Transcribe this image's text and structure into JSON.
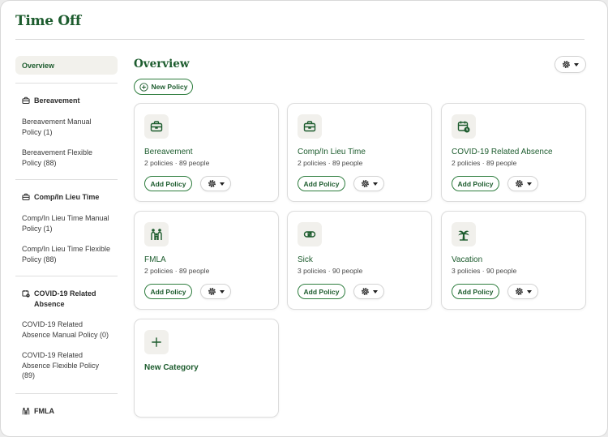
{
  "header": {
    "title": "Time Off"
  },
  "sidebar": {
    "overview_label": "Overview",
    "groups": [
      {
        "label": "Bereavement",
        "icon": "briefcase-icon",
        "items": [
          "Bereavement Manual Policy (1)",
          "Bereavement Flexible Policy (88)"
        ]
      },
      {
        "label": "Comp/In Lieu Time",
        "icon": "briefcase-icon",
        "items": [
          "Comp/In Lieu Time Manual Policy (1)",
          "Comp/In Lieu Time Flexible Policy (88)"
        ]
      },
      {
        "label": "COVID-19 Related Absence",
        "icon": "calendar-clock-icon",
        "items": [
          "COVID-19 Related Absence Manual Policy (0)",
          "COVID-19 Related Absence Flexible Policy (89)"
        ]
      },
      {
        "label": "FMLA",
        "icon": "family-icon",
        "items": []
      }
    ]
  },
  "main": {
    "title": "Overview",
    "new_policy_label": "New Policy",
    "settings_icon": "gear-icon",
    "cards": [
      {
        "name": "Bereavement",
        "meta": "2 policies · 89 people",
        "icon": "briefcase-icon",
        "add_label": "Add Policy"
      },
      {
        "name": "Comp/In Lieu Time",
        "meta": "2 policies · 89 people",
        "icon": "briefcase-icon",
        "add_label": "Add Policy"
      },
      {
        "name": "COVID-19 Related Absence",
        "meta": "2 policies · 89 people",
        "icon": "calendar-clock-icon",
        "add_label": "Add Policy"
      },
      {
        "name": "FMLA",
        "meta": "2 policies · 89 people",
        "icon": "family-icon",
        "add_label": "Add Policy"
      },
      {
        "name": "Sick",
        "meta": "3 policies · 90 people",
        "icon": "bandage-icon",
        "add_label": "Add Policy"
      },
      {
        "name": "Vacation",
        "meta": "3 policies · 90 people",
        "icon": "palm-tree-icon",
        "add_label": "Add Policy"
      }
    ],
    "new_category_label": "New Category"
  },
  "colors": {
    "brand_green": "#1d5c2e",
    "accent_border": "#2e7d3e",
    "icon_bg": "#f1f0ec"
  }
}
